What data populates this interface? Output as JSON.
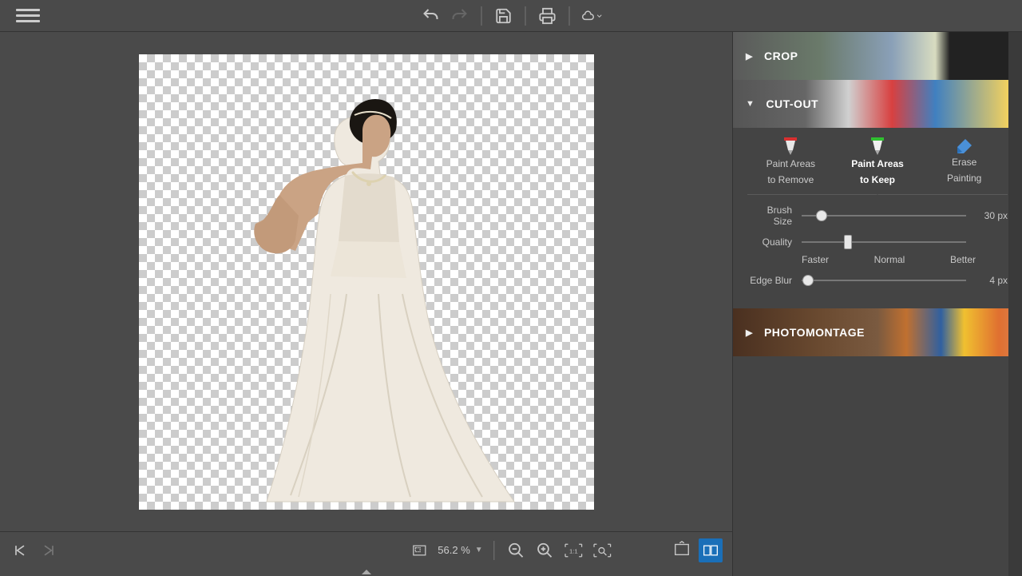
{
  "toolbar": {
    "undo": "Undo",
    "redo": "Redo",
    "save": "Save",
    "print": "Print",
    "share": "Share"
  },
  "accordion": {
    "crop": "CROP",
    "cutout": "CUT-OUT",
    "photomontage": "PHOTOMONTAGE"
  },
  "cutout_tools": {
    "remove": {
      "line1": "Paint Areas",
      "line2": "to Remove"
    },
    "keep": {
      "line1": "Paint Areas",
      "line2": "to Keep"
    },
    "erase": {
      "line1": "Erase",
      "line2": "Painting"
    }
  },
  "sliders": {
    "brush_size": {
      "label": "Brush Size",
      "value": "30 px",
      "pos": 12
    },
    "quality": {
      "label": "Quality",
      "pos": 28,
      "faster": "Faster",
      "normal": "Normal",
      "better": "Better"
    },
    "edge_blur": {
      "label": "Edge Blur",
      "value": "4 px",
      "pos": 4
    }
  },
  "bottom": {
    "zoom": "56.2 %"
  }
}
